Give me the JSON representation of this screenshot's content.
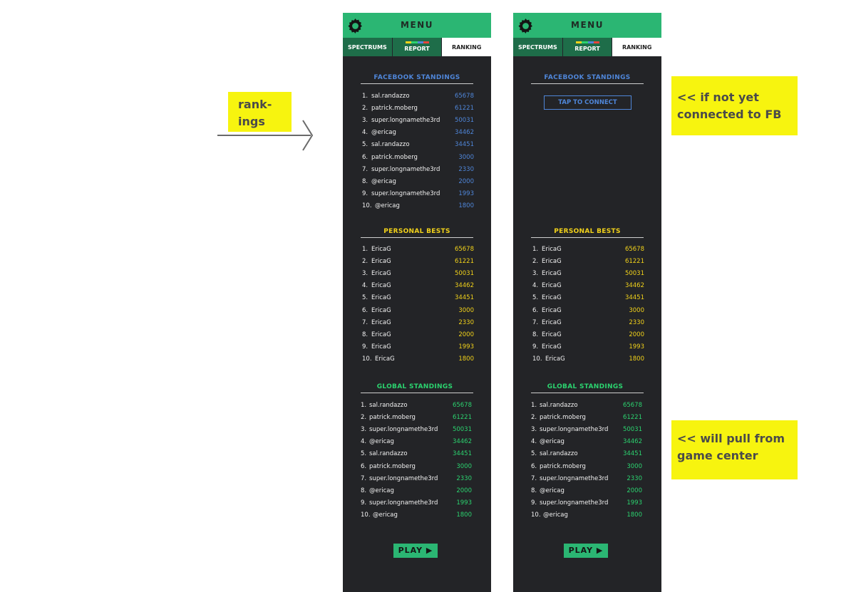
{
  "notes": {
    "rankings": "rank-\nings",
    "fb": "<< if not yet\nconnected to FB",
    "game_center": "<< will pull from\ngame center"
  },
  "colors": {
    "green": "#2bb673",
    "dark_green": "#1e6d49",
    "panel": "#232427",
    "facebook_blue": "#4f86d9",
    "personal_yellow": "#f2d21a",
    "global_green": "#2bd36f",
    "note_yellow": "#f7f40f"
  },
  "phone1": {
    "menu_title": "MENU",
    "tabs": [
      "SPECTRUMS",
      "REPORT",
      "RANKING"
    ],
    "facebook": {
      "title": "FACEBOOK STANDINGS",
      "rows": [
        {
          "rank": "1.",
          "name": "sal.randazzo",
          "score": "65678"
        },
        {
          "rank": "2.",
          "name": "patrick.moberg",
          "score": "61221"
        },
        {
          "rank": "3.",
          "name": "super.longnamethe3rd",
          "score": "50031"
        },
        {
          "rank": "4.",
          "name": "@ericag",
          "score": "34462"
        },
        {
          "rank": "5.",
          "name": "sal.randazzo",
          "score": "34451"
        },
        {
          "rank": "6.",
          "name": "patrick.moberg",
          "score": "3000"
        },
        {
          "rank": "7.",
          "name": "super.longnamethe3rd",
          "score": "2330"
        },
        {
          "rank": "8.",
          "name": "@ericag",
          "score": "2000"
        },
        {
          "rank": "9.",
          "name": "super.longnamethe3rd",
          "score": "1993"
        },
        {
          "rank": "10.",
          "name": "@ericag",
          "score": "1800"
        }
      ]
    },
    "personal": {
      "title": "PERSONAL BESTS",
      "rows": [
        {
          "rank": "1.",
          "name": "EricaG",
          "score": "65678"
        },
        {
          "rank": "2.",
          "name": "EricaG",
          "score": "61221"
        },
        {
          "rank": "3.",
          "name": "EricaG",
          "score": "50031"
        },
        {
          "rank": "4.",
          "name": "EricaG",
          "score": "34462"
        },
        {
          "rank": "5.",
          "name": "EricaG",
          "score": "34451"
        },
        {
          "rank": "6.",
          "name": "EricaG",
          "score": "3000"
        },
        {
          "rank": "7.",
          "name": "EricaG",
          "score": "2330"
        },
        {
          "rank": "8.",
          "name": "EricaG",
          "score": "2000"
        },
        {
          "rank": "9.",
          "name": "EricaG",
          "score": "1993"
        },
        {
          "rank": "10.",
          "name": "EricaG",
          "score": "1800"
        }
      ]
    },
    "global": {
      "title": "GLOBAL STANDINGS",
      "rows": [
        {
          "rank": "1.",
          "name": "sal.randazzo",
          "score": "65678"
        },
        {
          "rank": "2.",
          "name": "patrick.moberg",
          "score": "61221"
        },
        {
          "rank": "3.",
          "name": "super.longnamethe3rd",
          "score": "50031"
        },
        {
          "rank": "4.",
          "name": "@ericag",
          "score": "34462"
        },
        {
          "rank": "5.",
          "name": "sal.randazzo",
          "score": "34451"
        },
        {
          "rank": "6.",
          "name": "patrick.moberg",
          "score": "3000"
        },
        {
          "rank": "7.",
          "name": "super.longnamethe3rd",
          "score": "2330"
        },
        {
          "rank": "8.",
          "name": "@ericag",
          "score": "2000"
        },
        {
          "rank": "9.",
          "name": "super.longnamethe3rd",
          "score": "1993"
        },
        {
          "rank": "10.",
          "name": "@ericag",
          "score": "1800"
        }
      ]
    },
    "play_label": "PLAY ▶"
  },
  "phone2": {
    "menu_title": "MENU",
    "tabs": [
      "SPECTRUMS",
      "REPORT",
      "RANKING"
    ],
    "facebook": {
      "title": "FACEBOOK STANDINGS",
      "connect_label": "TAP TO CONNECT"
    },
    "personal": {
      "title": "PERSONAL BESTS",
      "rows": [
        {
          "rank": "1.",
          "name": "EricaG",
          "score": "65678"
        },
        {
          "rank": "2.",
          "name": "EricaG",
          "score": "61221"
        },
        {
          "rank": "3.",
          "name": "EricaG",
          "score": "50031"
        },
        {
          "rank": "4.",
          "name": "EricaG",
          "score": "34462"
        },
        {
          "rank": "5.",
          "name": "EricaG",
          "score": "34451"
        },
        {
          "rank": "6.",
          "name": "EricaG",
          "score": "3000"
        },
        {
          "rank": "7.",
          "name": "EricaG",
          "score": "2330"
        },
        {
          "rank": "8.",
          "name": "EricaG",
          "score": "2000"
        },
        {
          "rank": "9.",
          "name": "EricaG",
          "score": "1993"
        },
        {
          "rank": "10.",
          "name": "EricaG",
          "score": "1800"
        }
      ]
    },
    "global": {
      "title": "GLOBAL STANDINGS",
      "rows": [
        {
          "rank": "1.",
          "name": "sal.randazzo",
          "score": "65678"
        },
        {
          "rank": "2.",
          "name": "patrick.moberg",
          "score": "61221"
        },
        {
          "rank": "3.",
          "name": "super.longnamethe3rd",
          "score": "50031"
        },
        {
          "rank": "4.",
          "name": "@ericag",
          "score": "34462"
        },
        {
          "rank": "5.",
          "name": "sal.randazzo",
          "score": "34451"
        },
        {
          "rank": "6.",
          "name": "patrick.moberg",
          "score": "3000"
        },
        {
          "rank": "7.",
          "name": "super.longnamethe3rd",
          "score": "2330"
        },
        {
          "rank": "8.",
          "name": "@ericag",
          "score": "2000"
        },
        {
          "rank": "9.",
          "name": "super.longnamethe3rd",
          "score": "1993"
        },
        {
          "rank": "10.",
          "name": "@ericag",
          "score": "1800"
        }
      ]
    },
    "play_label": "PLAY ▶"
  }
}
